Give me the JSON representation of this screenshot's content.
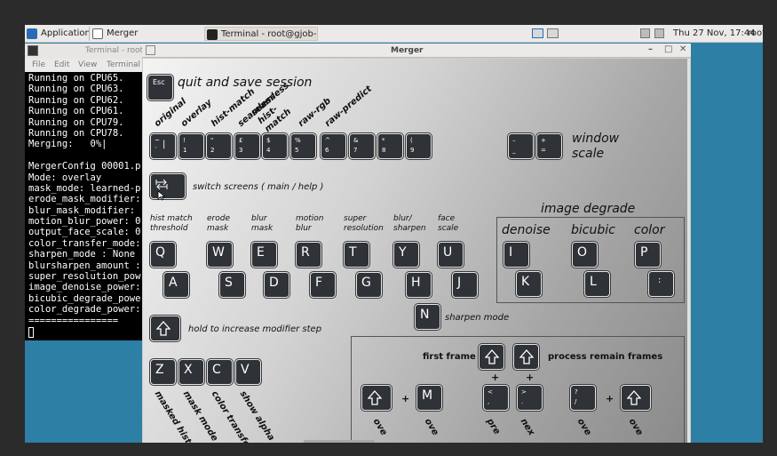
{
  "taskbar": {
    "applications_label": "Applications",
    "merger_task": "Merger",
    "terminal_task": "Terminal - root@gjob-de...",
    "clock": "Thu 27 Nov, 17:44",
    "user": "root"
  },
  "terminal": {
    "title": "Terminal - root",
    "menu": [
      "File",
      "Edit",
      "View",
      "Terminal"
    ],
    "lines": [
      "Running on CPU65.",
      "Running on CPU63.",
      "Running on CPU62.",
      "Running on CPU61.",
      "Running on CPU79.",
      "Running on CPU78.",
      "Merging:   0%|",
      "",
      "MergerConfig 00001.p",
      "Mode: overlay",
      "mask_mode: learned-p",
      "erode_mask_modifier:",
      "blur_mask_modifier:",
      "motion_blur_power: 0",
      "output_face_scale: 0",
      "color_transfer_mode:",
      "sharpen_mode : None",
      "blursharpen_amount :",
      "super_resolution_pow",
      "image_denoise_power:",
      "bicubic_degrade_powe",
      "color_degrade_power:",
      "================"
    ]
  },
  "merger": {
    "title": "Merger",
    "esc_key": "Esc",
    "quit_label": "quit and save session",
    "mode_labels": [
      "original",
      "overlay",
      "hist-match",
      "seamless",
      "seamless hist-match",
      "raw-rgb",
      "raw-predict"
    ],
    "number_keys": [
      {
        "top": "~",
        "bottom": "`",
        "main": "|"
      },
      {
        "top": "!",
        "bottom": "1"
      },
      {
        "top": "\"",
        "bottom": "2"
      },
      {
        "top": "£",
        "bottom": "3"
      },
      {
        "top": "$",
        "bottom": "4"
      },
      {
        "top": "%",
        "bottom": "5"
      },
      {
        "top": "^",
        "bottom": "6"
      },
      {
        "top": "&",
        "bottom": "7"
      },
      {
        "top": "*",
        "bottom": "8"
      },
      {
        "top": "(",
        "bottom": "9"
      }
    ],
    "window_scale_keys": [
      {
        "top": "–",
        "bottom": "_"
      },
      {
        "top": "+",
        "bottom": "="
      }
    ],
    "window_scale_label": "window scale",
    "switch_screens_label": "switch screens ( main / help )",
    "column_labels": [
      "hist match threshold",
      "erode mask",
      "blur mask",
      "motion blur",
      "super resolution",
      "blur/ sharpen",
      "face scale"
    ],
    "top_row_keys": [
      "Q",
      "W",
      "E",
      "R",
      "T",
      "Y",
      "U"
    ],
    "bottom_row_keys": [
      "A",
      "S",
      "D",
      "F",
      "G",
      "H",
      "J"
    ],
    "sharpen_key": "N",
    "sharpen_label": "sharpen mode",
    "image_degrade_title": "image degrade",
    "degrade_labels": [
      "denoise",
      "bicubic",
      "color"
    ],
    "degrade_top_keys": [
      "I",
      "O",
      "P"
    ],
    "degrade_bottom_keys": [
      "K",
      "L",
      ":"
    ],
    "modifier_label": "hold to increase modifier step",
    "bottom_keys": [
      "Z",
      "X",
      "C",
      "V"
    ],
    "bottom_rot_labels": [
      "masked hist",
      "mask mode",
      "color transfer",
      "show alpha"
    ],
    "first_frame_label": "first frame",
    "process_remain_label": "process remain frames",
    "plus": "+",
    "m_key": "M",
    "nav_keys": [
      {
        "top": "<",
        "bottom": ","
      },
      {
        "top": ">",
        "bottom": "."
      },
      {
        "top": "?",
        "bottom": "/"
      }
    ],
    "nav_rot_labels": [
      "ove",
      "ove",
      "pre",
      "nex",
      "ove",
      "ove"
    ]
  }
}
